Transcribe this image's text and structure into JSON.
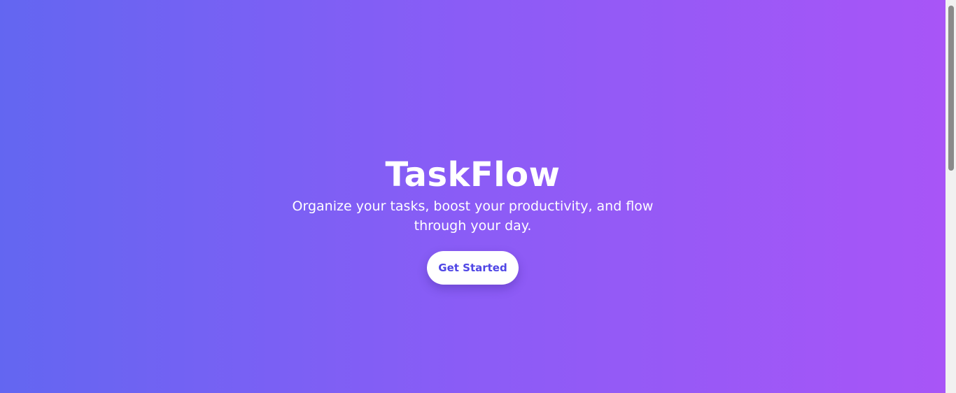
{
  "hero": {
    "title": "TaskFlow",
    "tagline": "Organize your tasks, boost your productivity, and flow through your day.",
    "cta_label": "Get Started"
  },
  "colors": {
    "gradient_start": "#6366f1",
    "gradient_end": "#a855f7",
    "button_bg": "#ffffff",
    "button_text": "#4f46e5"
  }
}
